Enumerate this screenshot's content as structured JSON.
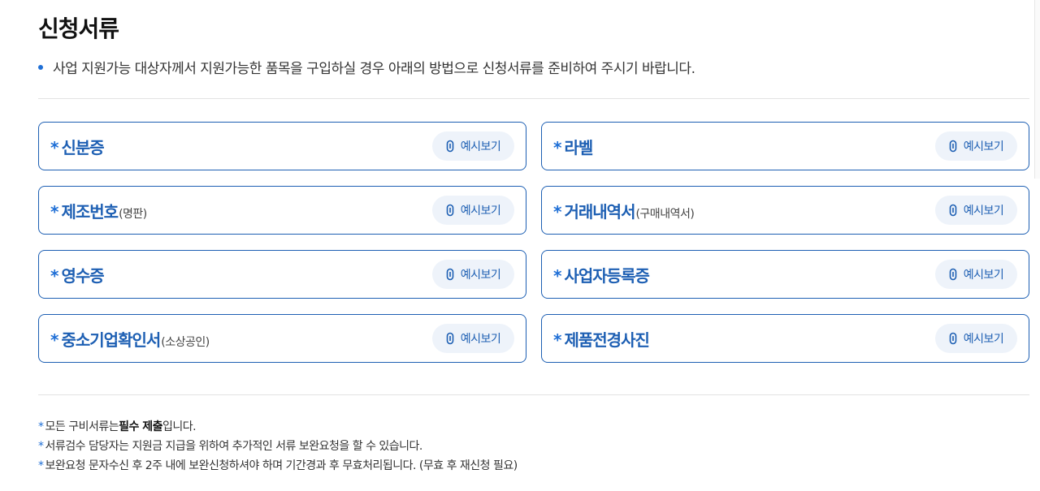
{
  "title": "신청서류",
  "intro": "사업 지원가능 대상자께서 지원가능한 품목을 구입하실 경우 아래의 방법으로 신청서류를 준비하여 주시기 바랍니다.",
  "example_label": "예시보기",
  "documents": [
    {
      "star": "*",
      "name": "신분증",
      "sub": ""
    },
    {
      "star": "*",
      "name": "라벨",
      "sub": ""
    },
    {
      "star": "*",
      "name": "제조번호",
      "sub": "(명판)"
    },
    {
      "star": "*",
      "name": "거래내역서",
      "sub": "(구매내역서)"
    },
    {
      "star": "*",
      "name": "영수증",
      "sub": ""
    },
    {
      "star": "*",
      "name": "사업자등록증",
      "sub": ""
    },
    {
      "star": "*",
      "name": "중소기업확인서",
      "sub": "(소상공인)"
    },
    {
      "star": "*",
      "name": "제품전경사진",
      "sub": ""
    }
  ],
  "notes": {
    "n1_before": "모든 구비서류는 ",
    "n1_bold": "필수 제출",
    "n1_after": "입니다.",
    "n2": "서류검수 담당자는 지원금 지급을 위하여 추가적인 서류 보완요청을 할 수 있습니다.",
    "n3": "보완요청 문자수신 후 2주 내에 보완신청하셔야 하며 기간경과 후 무효처리됩니다. (무효 후 재신청 필요)",
    "star": "*"
  },
  "icons": {
    "example_button": "paperclip-icon"
  },
  "colors": {
    "accent": "#1d5fb3",
    "button_bg": "#eef3fa",
    "divider": "#e2e2e2"
  }
}
